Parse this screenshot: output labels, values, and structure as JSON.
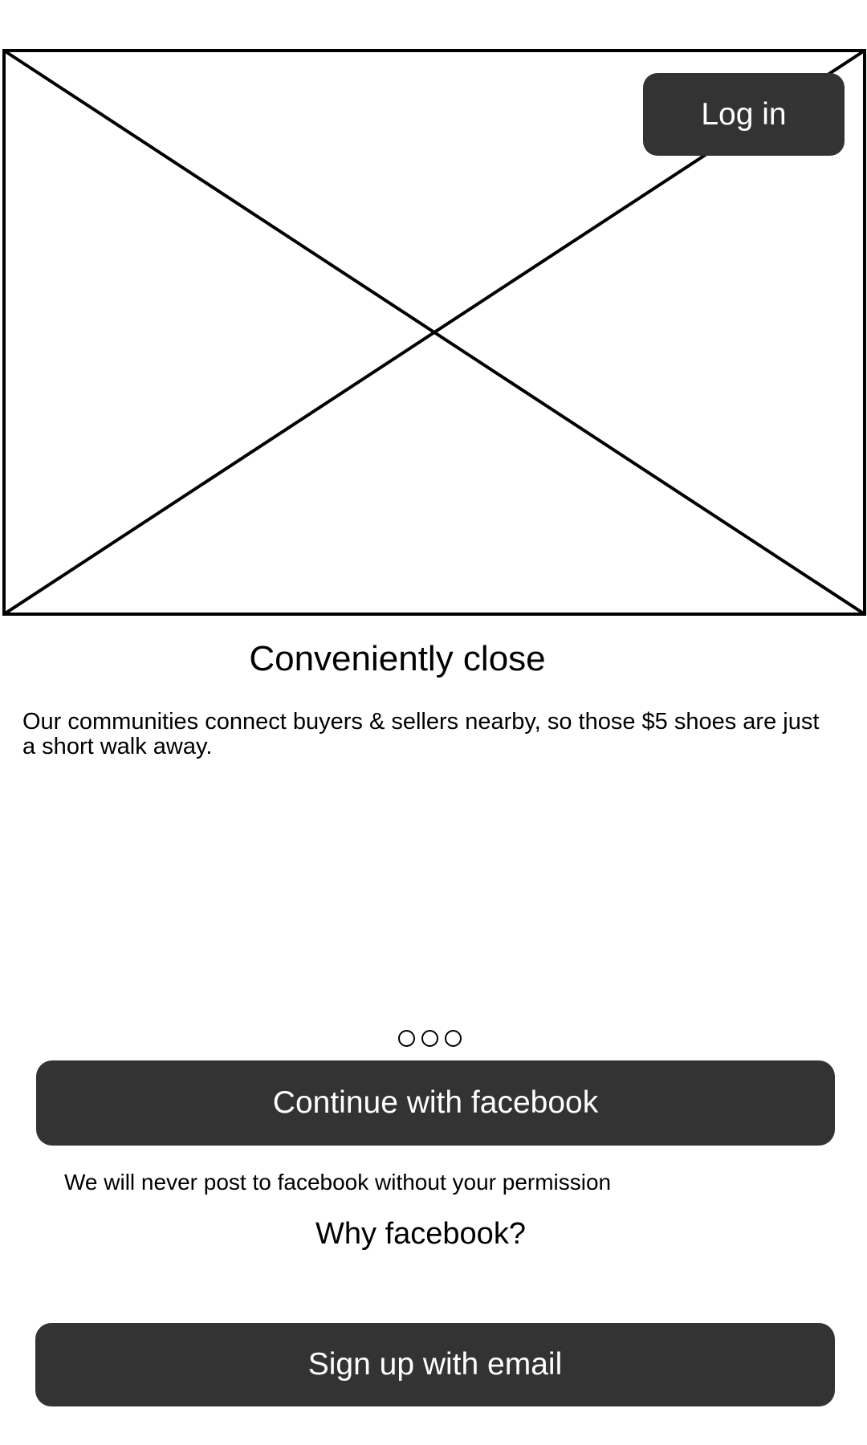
{
  "header": {
    "login_label": "Log in"
  },
  "hero": {
    "image_placeholder": "image-placeholder"
  },
  "onboarding": {
    "title": "Conveniently close",
    "description": "Our communities connect buyers & sellers nearby, so those $5 shoes are just a short walk away.",
    "page_count": 3
  },
  "actions": {
    "facebook_label": "Continue with facebook",
    "facebook_note": "We will never post to facebook without your permission",
    "why_facebook": "Why facebook?",
    "email_label": "Sign up with email"
  },
  "colors": {
    "button_bg": "#333333",
    "button_text": "#ffffff"
  }
}
